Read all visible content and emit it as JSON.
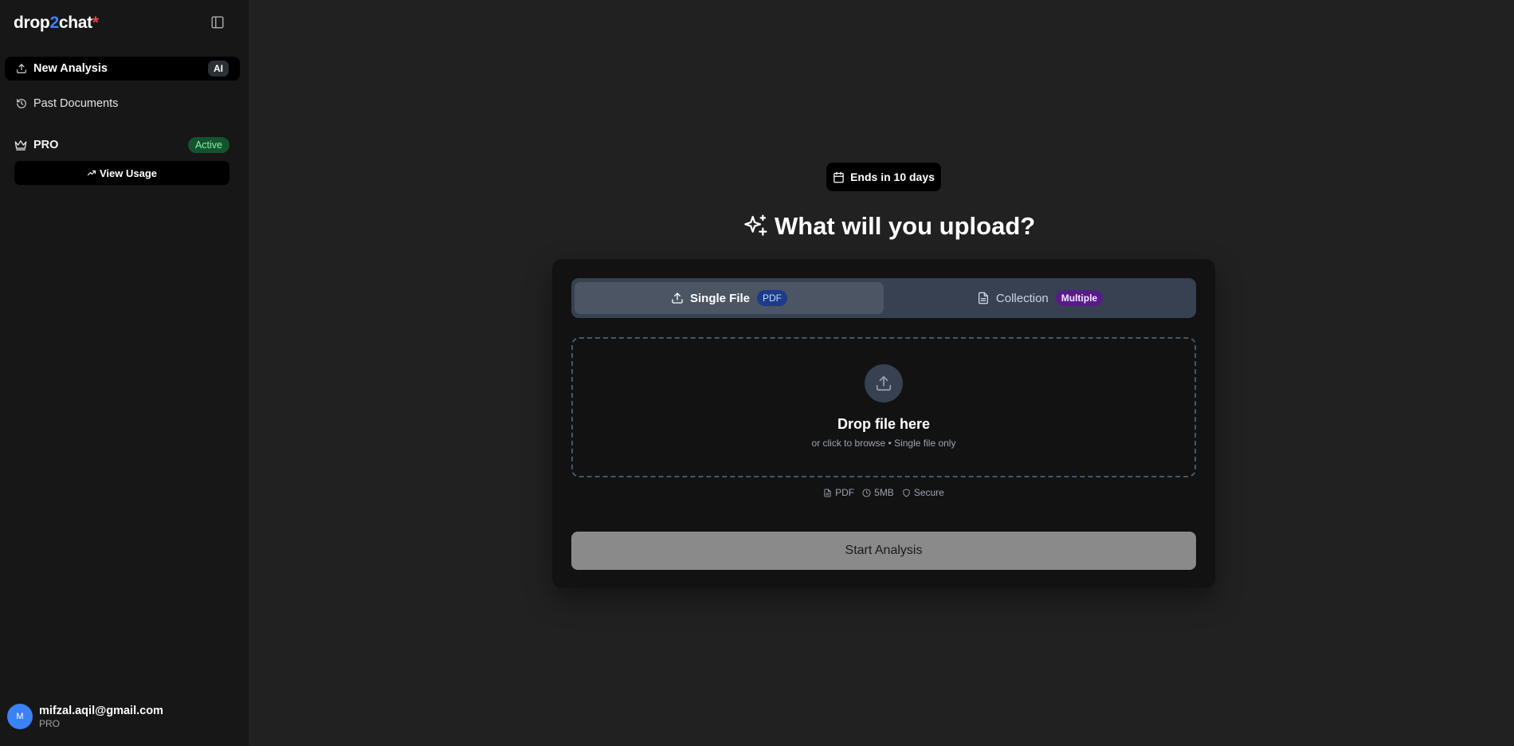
{
  "brand": {
    "part1": "drop",
    "part2": "2",
    "part3": "chat",
    "star": "*"
  },
  "sidebar": {
    "nav": [
      {
        "label": "New Analysis",
        "badge": "AI",
        "icon": "upload-icon"
      },
      {
        "label": "Past Documents",
        "icon": "history-icon"
      }
    ],
    "plan": {
      "label": "PRO",
      "status": "Active",
      "icon": "crown-icon"
    },
    "view_usage": "View Usage",
    "user": {
      "initial": "M",
      "email": "mifzal.aqil@gmail.com",
      "plan": "PRO"
    }
  },
  "main": {
    "ends_pill": "Ends in 10 days",
    "headline": "What will you upload?",
    "tabs": [
      {
        "label": "Single File",
        "badge": "PDF",
        "selected": true
      },
      {
        "label": "Collection",
        "badge": "Multiple",
        "selected": false
      }
    ],
    "dropzone": {
      "title": "Drop file here",
      "subtitle": "or click to browse • Single file only"
    },
    "meta": [
      {
        "label": "PDF",
        "icon": "file-icon"
      },
      {
        "label": "5MB",
        "icon": "clock-icon"
      },
      {
        "label": "Secure",
        "icon": "shield-icon"
      }
    ],
    "start_button": "Start Analysis"
  },
  "colors": {
    "background": "#212121",
    "sidebar": "#171717",
    "accent_blue": "#3b82f6",
    "brand_star": "#ef4444",
    "active_green": "#14532d",
    "pdf_badge": "#1e3a8a",
    "multiple_badge": "#581c87"
  }
}
